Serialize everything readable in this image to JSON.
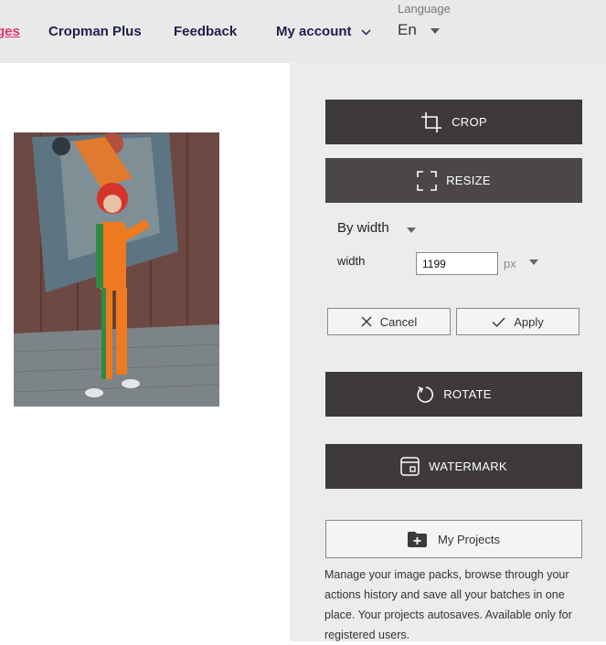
{
  "nav": {
    "active_partial": "ges",
    "cropman_plus": "Cropman Plus",
    "feedback": "Feedback",
    "my_account": "My account"
  },
  "language": {
    "label": "Language",
    "value": "En"
  },
  "tools": {
    "crop": "CROP",
    "resize": "RESIZE",
    "rotate": "ROTATE",
    "watermark": "WATERMARK"
  },
  "resize_options": {
    "mode": "By width",
    "width_label": "width",
    "width_value": "1199",
    "unit": "px"
  },
  "actions": {
    "cancel": "Cancel",
    "apply": "Apply"
  },
  "projects": {
    "label": "My Projects",
    "description": "Manage your image packs, browse through your actions history and save all your batches in one place. Your projects autosaves. Available only for registered users."
  },
  "colors": {
    "accent": "#e8336b",
    "nav_text": "#1f1f4d",
    "tool_button": "#3d3a39"
  }
}
